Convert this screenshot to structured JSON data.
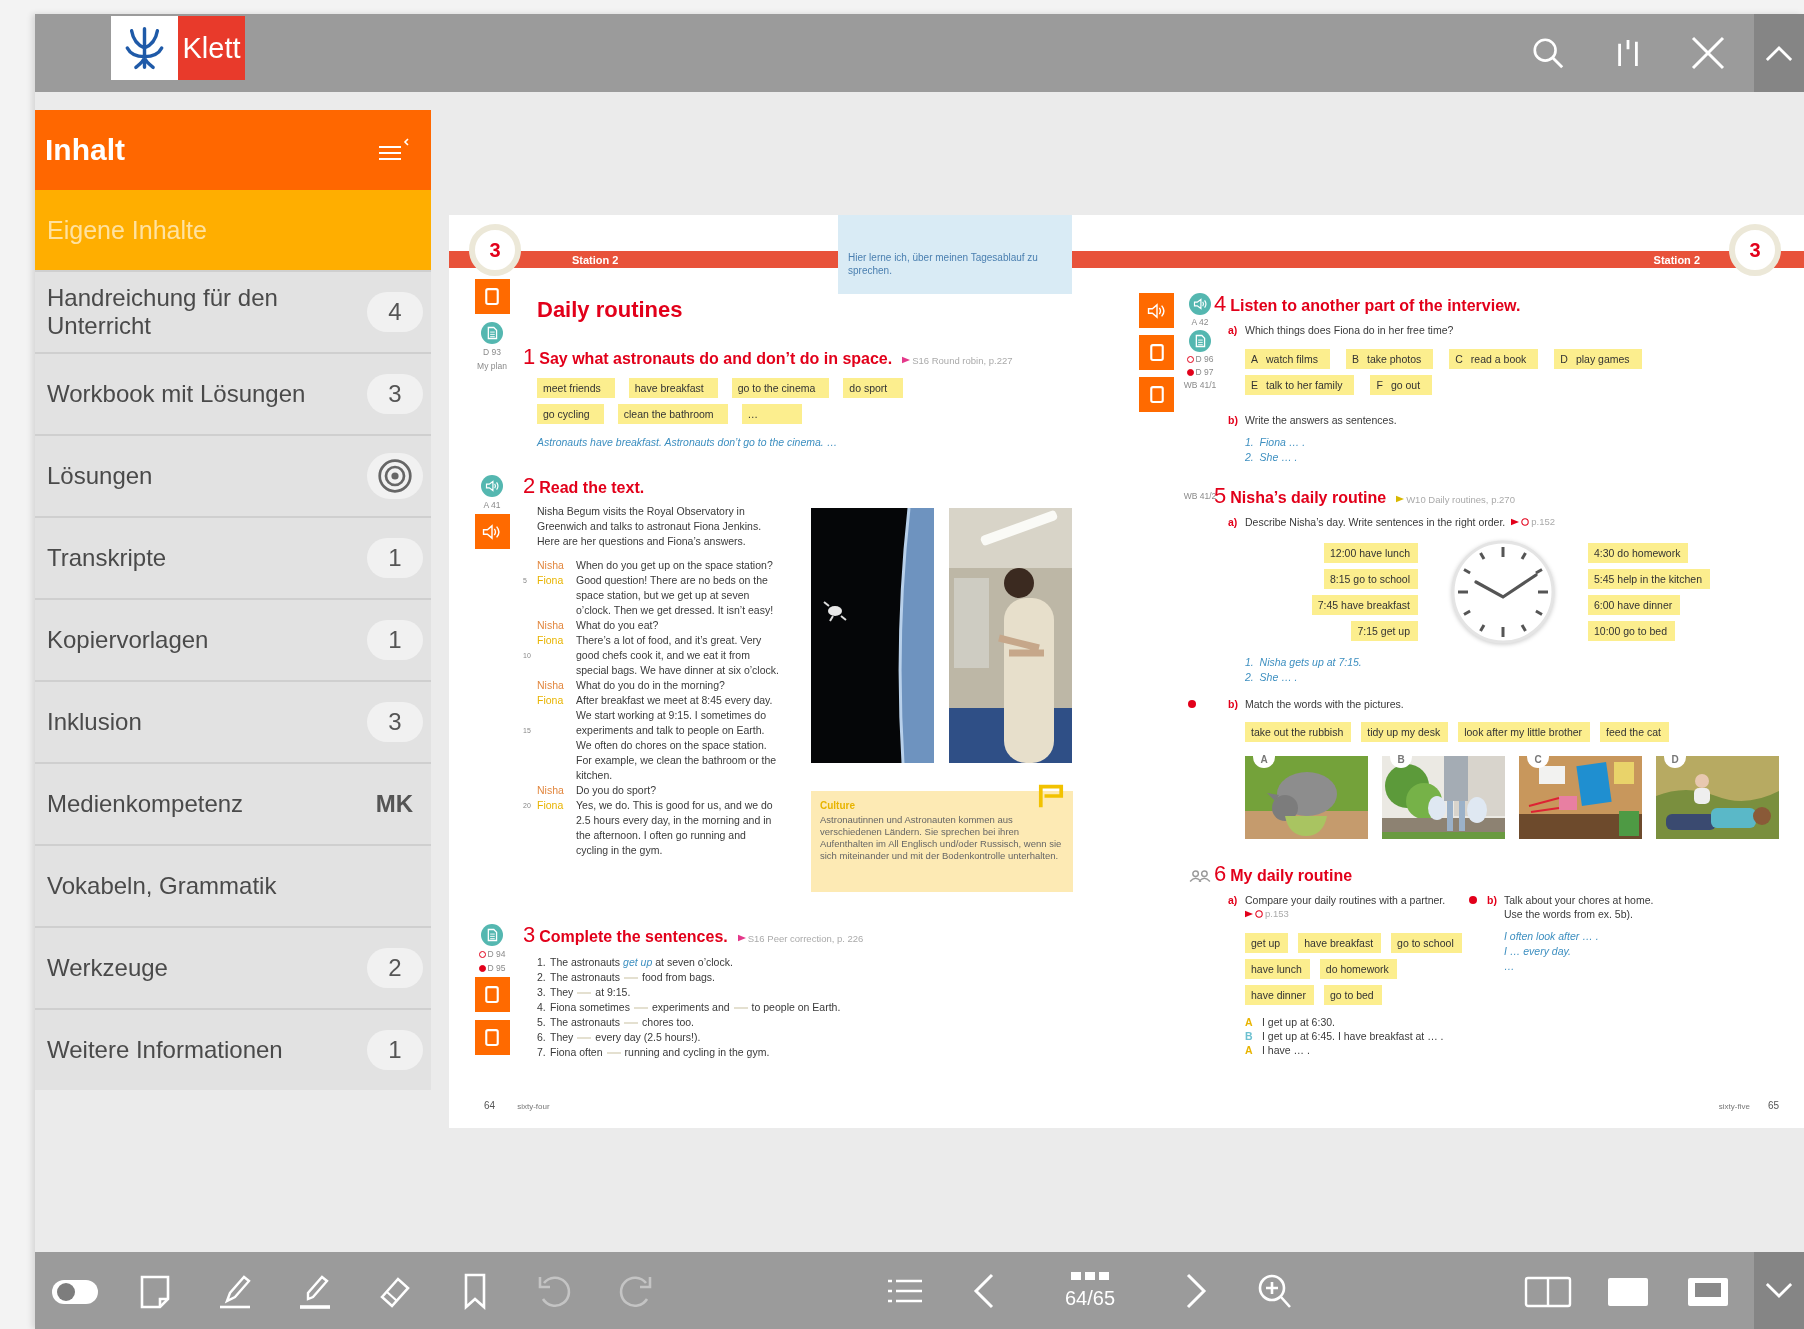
{
  "top_bar": {
    "logo": "Klett"
  },
  "sidebar": {
    "title": "Inhalt",
    "own_content": "Eigene Inhalte",
    "items": [
      {
        "label": "Handreichung für den Unterricht",
        "kind": "count",
        "badge": "4"
      },
      {
        "label": "Workbook mit Lösungen",
        "kind": "count",
        "badge": "3"
      },
      {
        "label": "Lösungen",
        "kind": "target"
      },
      {
        "label": "Transkripte",
        "kind": "count",
        "badge": "1"
      },
      {
        "label": "Kopiervorlagen",
        "kind": "count",
        "badge": "1"
      },
      {
        "label": "Inklusion",
        "kind": "count",
        "badge": "3"
      },
      {
        "label": "Medienkompetenz",
        "kind": "code",
        "badge": "MK"
      },
      {
        "label": "Vokabeln, Grammatik",
        "kind": "plain"
      },
      {
        "label": "Werkzeuge",
        "kind": "count",
        "badge": "2"
      },
      {
        "label": "Weitere Informationen",
        "kind": "count",
        "badge": "1"
      }
    ]
  },
  "book": {
    "left_page": {
      "chapter": "3",
      "station": "Station 2",
      "goal_note": "Hier lerne ich, über meinen Tagesablauf zu sprechen.",
      "title": "Daily routines",
      "title_margin": [
        {
          "kind": "page_button"
        },
        {
          "kind": "document"
        },
        {
          "kind": "ref",
          "label": "D 93"
        },
        {
          "kind": "ref",
          "label": "My plan"
        }
      ],
      "exercise_1": {
        "number": "1",
        "heading": "Say what astronauts do and don’t do in space.",
        "ref": {
          "kind": "skill",
          "text": "S16 Round robin, p.227"
        },
        "chips": [
          "meet friends",
          "have breakfast",
          "go to the cinema",
          "do sport",
          "go cycling",
          "clean the bathroom",
          "…"
        ],
        "example": "Astronauts have breakfast. Astronauts don’t go to the cinema. …"
      },
      "exercise_2": {
        "number": "2",
        "heading": "Read the text.",
        "margin": [
          {
            "kind": "speaker"
          },
          {
            "kind": "ref",
            "label": "A 41"
          },
          {
            "kind": "audio_button"
          }
        ],
        "intro": "Nisha Begum visits the Royal Observatory in Greenwich and talks to astronaut Fiona Jenkins. Here are her questions and Fiona’s answers.",
        "dialogue": [
          {
            "speaker": "Nisha",
            "color": "#e2873f",
            "lines": [
              {
                "text": "When do you get up on the space station?"
              }
            ]
          },
          {
            "speaker": "Fiona",
            "color": "#e8b400",
            "lines": [
              {
                "no": "5",
                "text": "Good question! There are no beds on the"
              },
              {
                "text": "space station, but we get up at seven"
              },
              {
                "text": "o’clock. Then we get dressed. It isn’t easy!"
              }
            ]
          },
          {
            "speaker": "Nisha",
            "color": "#e2873f",
            "lines": [
              {
                "text": "What do you eat?"
              }
            ]
          },
          {
            "speaker": "Fiona",
            "color": "#e8b400",
            "lines": [
              {
                "text": "There’s a lot of food, and it’s great. Very"
              },
              {
                "no": "10",
                "text": "good chefs cook it, and we eat it from"
              },
              {
                "text": "special bags. We have dinner at six o’clock."
              }
            ]
          },
          {
            "speaker": "Nisha",
            "color": "#e2873f",
            "lines": [
              {
                "text": "What do you do in the morning?"
              }
            ]
          },
          {
            "speaker": "Fiona",
            "color": "#e8b400",
            "lines": [
              {
                "text": "After breakfast we meet at 8:45 every day."
              },
              {
                "text": "We start working at 9:15. I sometimes do"
              },
              {
                "no": "15",
                "text": "experiments and talk to people on Earth."
              },
              {
                "text": "We often do chores on the space station."
              },
              {
                "text": "For example, we clean the bathroom or the"
              },
              {
                "text": "kitchen."
              }
            ]
          },
          {
            "speaker": "Nisha",
            "color": "#e2873f",
            "lines": [
              {
                "text": "Do you do sport?"
              }
            ]
          },
          {
            "speaker": "Fiona",
            "color": "#e8b400",
            "lines": [
              {
                "no": "20",
                "text": "Yes, we do. This is good for us, and we do"
              },
              {
                "text": "2.5 hours every day, in the morning and in"
              },
              {
                "text": "the afternoon. I often go running and"
              },
              {
                "text": "cycling in the gym."
              }
            ]
          }
        ],
        "culture": {
          "label": "Culture",
          "text": "Astronautinnen und Astronauten kommen aus verschiedenen Ländern. Sie sprechen bei ihren Aufenthalten im All Englisch und/oder Russisch, wenn sie sich miteinander und mit der Bodenkontrolle unterhalten."
        }
      },
      "exercise_3": {
        "number": "3",
        "heading": "Complete the sentences.",
        "ref": {
          "kind": "skill",
          "text": "S16 Peer correction, p. 226"
        },
        "margin": [
          {
            "kind": "document"
          },
          {
            "kind": "level_ref",
            "label": "D 94",
            "filled": false
          },
          {
            "kind": "level_ref",
            "label": "D 95",
            "filled": true
          },
          {
            "kind": "page_button"
          },
          {
            "kind": "page_button"
          }
        ],
        "items": [
          {
            "no": "1.",
            "segments": [
              "The astronauts",
              "at seven o’clock."
            ],
            "answer": "get up"
          },
          {
            "no": "2.",
            "segments": [
              "The astronauts",
              "food from bags."
            ]
          },
          {
            "no": "3.",
            "segments": [
              "They",
              "at 9:15."
            ]
          },
          {
            "no": "4.",
            "segments": [
              "Fiona sometimes",
              "experiments and",
              "to people on Earth."
            ]
          },
          {
            "no": "5.",
            "segments": [
              "The astronauts",
              "chores too."
            ]
          },
          {
            "no": "6.",
            "segments": [
              "They",
              "every day (2.5 hours!)."
            ]
          },
          {
            "no": "7.",
            "segments": [
              "Fiona often",
              "running and cycling in the gym."
            ]
          }
        ]
      },
      "page_number": "64",
      "page_word": "sixty-four"
    },
    "right_page": {
      "chapter": "3",
      "station": "Station 2",
      "exercise_4": {
        "number": "4",
        "heading": "Listen to another part of the interview.",
        "margin_buttons": [
          {
            "kind": "audio_button"
          },
          {
            "kind": "page_button"
          },
          {
            "kind": "page_button"
          }
        ],
        "margin_marks": [
          {
            "kind": "speaker"
          },
          {
            "kind": "ref",
            "label": "A 42"
          },
          {
            "kind": "document"
          },
          {
            "kind": "level_ref",
            "label": "D 96",
            "filled": false
          },
          {
            "kind": "level_ref",
            "label": "D 97",
            "filled": true
          },
          {
            "kind": "ref",
            "label": "WB 41/1"
          }
        ],
        "part_a": {
          "label": "a)",
          "text": "Which things does Fiona do in her free time?",
          "chips": [
            {
              "letter": "A",
              "text": "watch films"
            },
            {
              "letter": "B",
              "text": "take photos"
            },
            {
              "letter": "C",
              "text": "read a book"
            },
            {
              "letter": "D",
              "text": "play games"
            },
            {
              "letter": "E",
              "text": "talk to her family"
            },
            {
              "letter": "F",
              "text": "go out"
            }
          ]
        },
        "part_b": {
          "label": "b)",
          "text": "Write the answers as sentences.",
          "examples": [
            "1.  Fiona … .",
            "2.  She … ."
          ]
        }
      },
      "exercise_5": {
        "number": "5",
        "heading": "Nisha’s daily routine",
        "ref": {
          "kind": "vocabulary",
          "text": "W10 Daily routines, p.270"
        },
        "margin_marks": [
          {
            "kind": "ref",
            "label": "WB 41/2"
          }
        ],
        "part_a": {
          "label": "a)",
          "text": "Describe Nisha’s day. Write sentences in the right order.",
          "ref": {
            "kind": "level",
            "text": "p.152"
          },
          "chips_left": [
            "12:00 have lunch",
            "8:15 go to school",
            "7:45 have breakfast",
            "7:15 get up"
          ],
          "chips_right": [
            "4:30 do homework",
            "5:45 help in the kitchen",
            "6:00 have dinner",
            "10:00 go to bed"
          ],
          "examples": [
            "1.  Nisha gets up at 7:15.",
            "2.  She … ."
          ]
        },
        "part_b": {
          "label": "b)",
          "marked": true,
          "text": "Match the words with the pictures.",
          "chips": [
            "take out the rubbish",
            "tidy up my desk",
            "look after my little brother",
            "feed the cat"
          ],
          "pictures": [
            {
              "letter": "A",
              "kind": "picture"
            },
            {
              "letter": "B",
              "kind": "picture"
            },
            {
              "letter": "C",
              "kind": "picture"
            },
            {
              "letter": "D",
              "kind": "picture"
            }
          ]
        }
      },
      "exercise_6": {
        "number": "6",
        "heading": "My daily routine",
        "margin_marks": [
          {
            "kind": "pair"
          }
        ],
        "part_a": {
          "label": "a)",
          "text": "Compare your daily routines with a partner.",
          "ref": {
            "kind": "level",
            "text": "p.153"
          },
          "chips": [
            "get up",
            "have breakfast",
            "go to school",
            "have lunch",
            "do homework",
            "have dinner",
            "go to bed"
          ],
          "dialogue": [
            {
              "speaker": "A",
              "color": "#e8b400",
              "text": "I get up at 6:30."
            },
            {
              "speaker": "B",
              "color": "#6cc0d0",
              "text": "I get up at 6:45. I have breakfast at … ."
            },
            {
              "speaker": "A",
              "color": "#e8b400",
              "text": "I have … ."
            }
          ]
        },
        "part_b": {
          "label": "b)",
          "marked": true,
          "lines": [
            "Talk about your chores at home.",
            "Use the words from ex. 5b)."
          ],
          "examples": [
            "I often look after … .",
            "I … every day.",
            "…"
          ]
        }
      },
      "page_number": "65",
      "page_word": "sixty-five"
    }
  },
  "toolbar": {
    "tools": [
      {
        "kind": "toggle",
        "disabled": false
      },
      {
        "kind": "note",
        "disabled": false
      },
      {
        "kind": "pencil",
        "disabled": false
      },
      {
        "kind": "highlighter",
        "disabled": false
      },
      {
        "kind": "eraser",
        "disabled": false
      },
      {
        "kind": "bookmark",
        "disabled": false
      },
      {
        "kind": "undo",
        "disabled": true
      },
      {
        "kind": "redo",
        "disabled": true
      }
    ],
    "page_indicator": "64/65"
  }
}
